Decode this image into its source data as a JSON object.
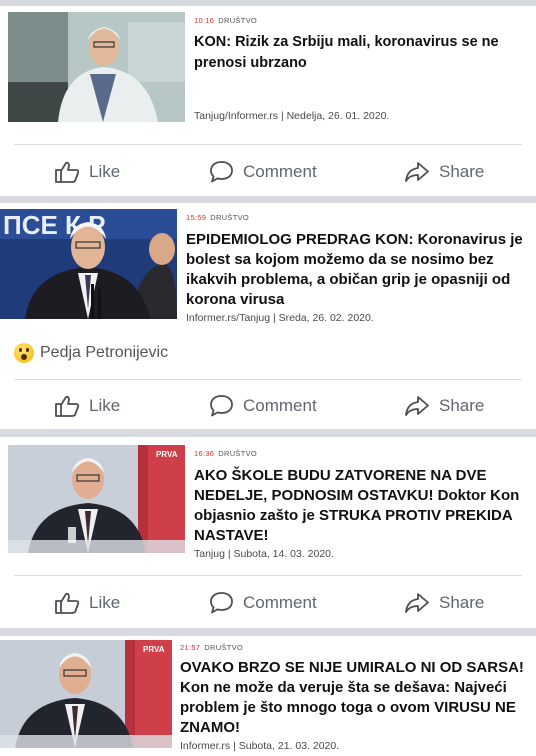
{
  "actions": {
    "like": "Like",
    "comment": "Comment",
    "share": "Share"
  },
  "posts": [
    {
      "time": "10:16",
      "category": "DRUŠTVO",
      "headline": "KON: Rizik za Srbiju mali, koronavirus se ne prenosi ubrzano",
      "source": "Tanjug/Informer.rs | Nedelja, 26. 01. 2020."
    },
    {
      "time": "15:59",
      "category": "DRUŠTVO",
      "headline": "EPIDEMIOLOG PREDRAG KON: Koronavirus je bolest sa kojom možemo da se nosimo bez ikakvih problema, a običan grip je opasniji od korona virusa",
      "source": "Informer.rs/Tanjug | Sreda, 26. 02. 2020.",
      "backdrop_text": "ПСЕ    К Р",
      "commenter": "Pedja Petronijevic"
    },
    {
      "time": "16:36",
      "category": "DRUŠTVO",
      "headline": "AKO ŠKOLE BUDU ZATVORENE NA DVE NEDELJE, PODNOSIM OSTAVKU! Doktor Kon objasnio zašto je STRUKA PROTIV PREKIDA NASTAVE!",
      "source": "Tanjug | Subota, 14. 03. 2020.",
      "logo_text": "PRVA"
    },
    {
      "time": "21:57",
      "category": "DRUŠTVO",
      "headline": "OVAKO BRZO SE NIJE UMIRALO NI OD SARSA! Kon ne može da veruje šta se dešava: Najveći problem je što mnogo toga o ovom VIRUSU NE ZNAMO!",
      "source": "Informer.rs | Subota, 21. 03. 2020.",
      "logo_text": "PRVA"
    }
  ]
}
